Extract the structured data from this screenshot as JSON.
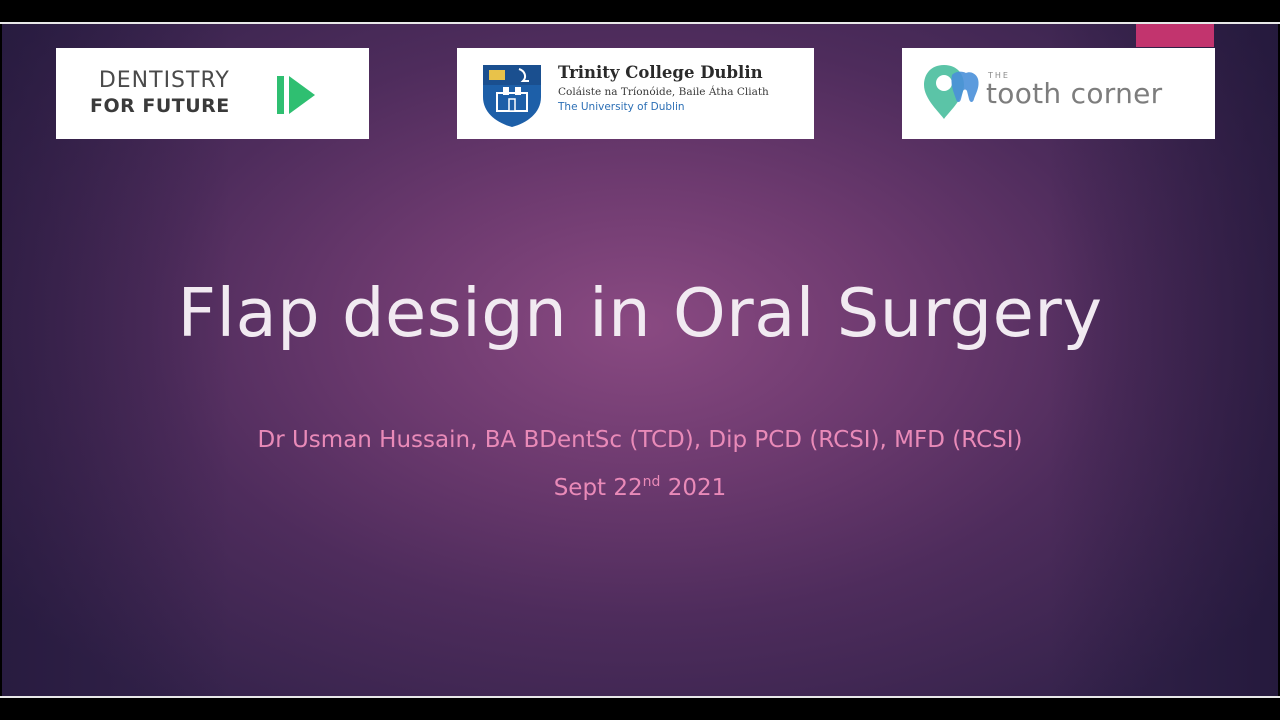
{
  "logos": {
    "dentistry_for_future": {
      "line1": "DENTISTRY",
      "line2": "FOR FUTURE",
      "icon": "play-arrow-icon",
      "color": "#2fbf71"
    },
    "trinity_college_dublin": {
      "name": "Trinity College Dublin",
      "irish_name": "Coláiste na Tríonóide, Baile Átha Cliath",
      "university": "The University of Dublin",
      "icon": "crest-icon",
      "color": "#1d5fa8"
    },
    "tooth_corner": {
      "the": "THE",
      "name": "tooth corner",
      "icon": "tooth-pin-icon",
      "color": "#5bc4a7"
    }
  },
  "slide": {
    "title": "Flap design in Oral Surgery",
    "author": "Dr Usman Hussain, BA BDentSc (TCD), Dip PCD (RCSI), MFD (RCSI)",
    "date_prefix": "Sept 22",
    "date_suffix": "nd",
    "date_year": " 2021"
  },
  "colors": {
    "background": "#6d3a6f",
    "title": "#f1eaf1",
    "accent_text": "#e98ab8",
    "accent_tab": "#c2346e"
  }
}
